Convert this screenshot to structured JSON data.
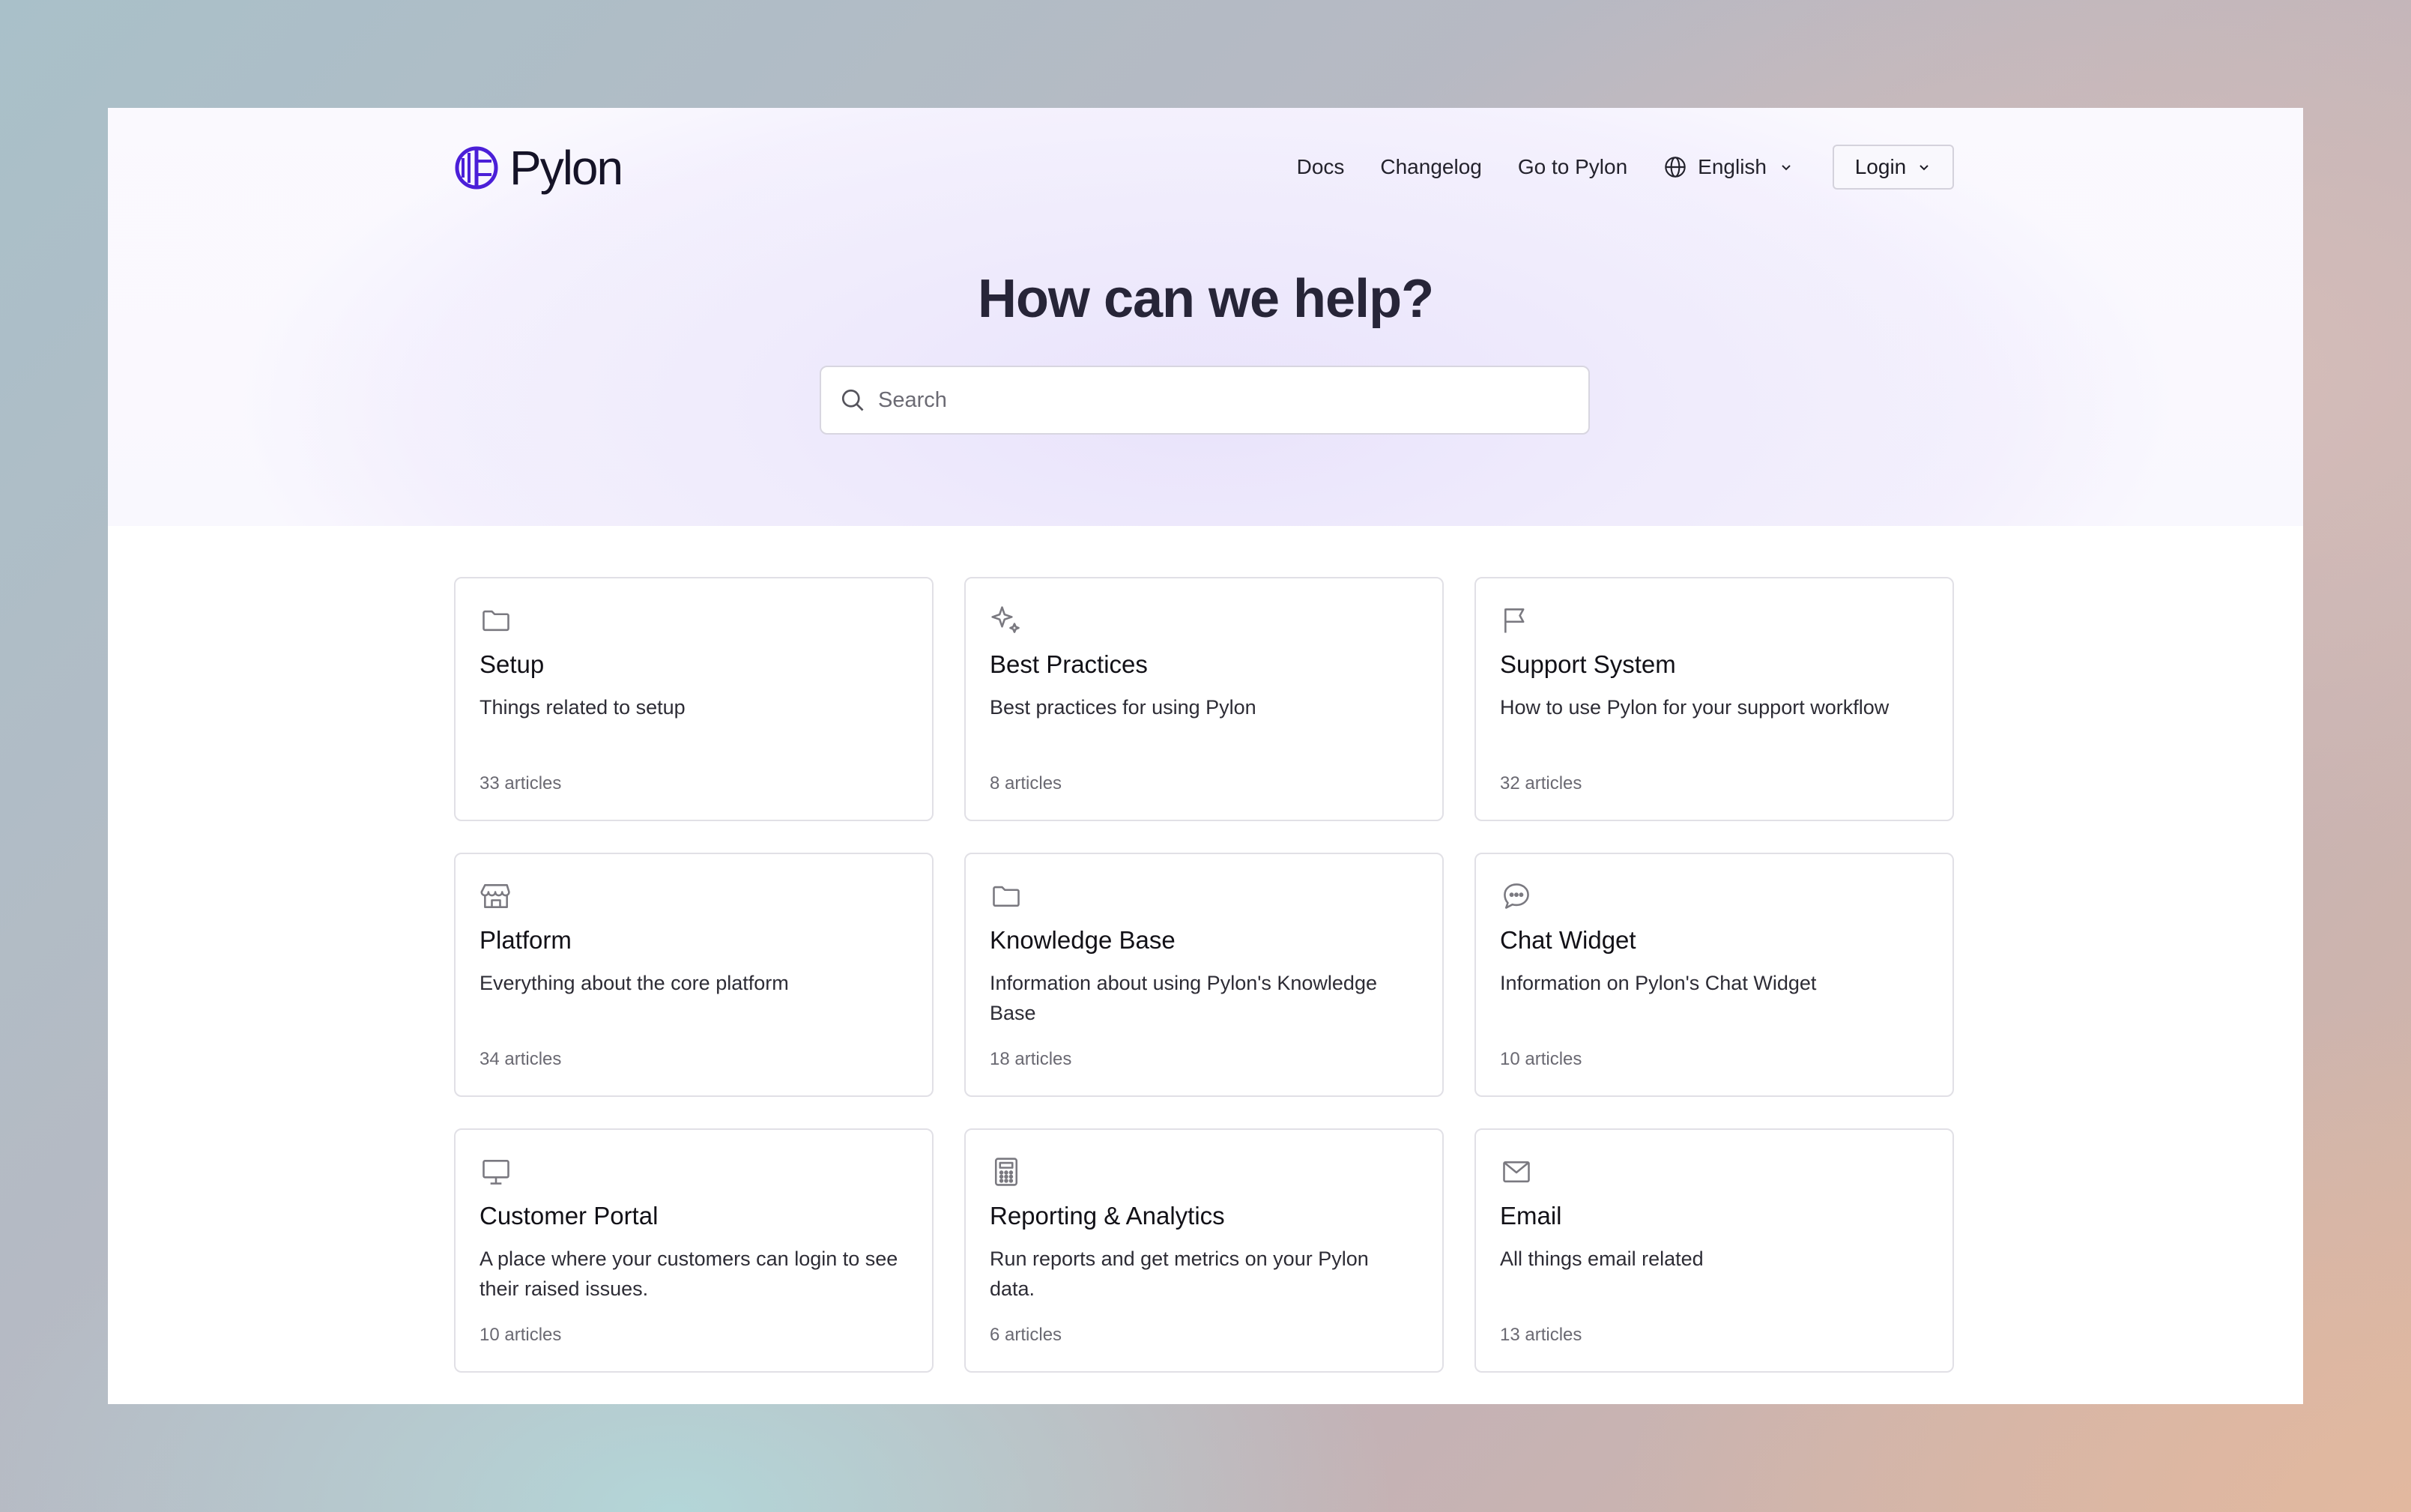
{
  "brand": {
    "name": "Pylon",
    "accent": "#4b1fd8"
  },
  "nav": {
    "links": [
      "Docs",
      "Changelog",
      "Go to Pylon"
    ],
    "language": "English",
    "login": "Login"
  },
  "hero": {
    "title": "How can we help?",
    "search_placeholder": "Search"
  },
  "collections": [
    {
      "icon": "folder-icon",
      "title": "Setup",
      "description": "Things related to setup",
      "count": "33 articles"
    },
    {
      "icon": "sparkles-icon",
      "title": "Best Practices",
      "description": "Best practices for using Pylon",
      "count": "8 articles"
    },
    {
      "icon": "flag-icon",
      "title": "Support System",
      "description": "How to use Pylon for your support workflow",
      "count": "32 articles"
    },
    {
      "icon": "storefront-icon",
      "title": "Platform",
      "description": "Everything about the core platform",
      "count": "34 articles"
    },
    {
      "icon": "folder-icon",
      "title": "Knowledge Base",
      "description": "Information about using Pylon's Knowledge Base",
      "count": "18 articles"
    },
    {
      "icon": "chat-bubble-icon",
      "title": "Chat Widget",
      "description": "Information on Pylon's Chat Widget",
      "count": "10 articles"
    },
    {
      "icon": "monitor-icon",
      "title": "Customer Portal",
      "description": "A place where your customers can login to see their raised issues.",
      "count": "10 articles"
    },
    {
      "icon": "calculator-icon",
      "title": "Reporting & Analytics",
      "description": "Run reports and get metrics on your Pylon data.",
      "count": "6 articles"
    },
    {
      "icon": "envelope-icon",
      "title": "Email",
      "description": "All things email related",
      "count": "13 articles"
    }
  ]
}
